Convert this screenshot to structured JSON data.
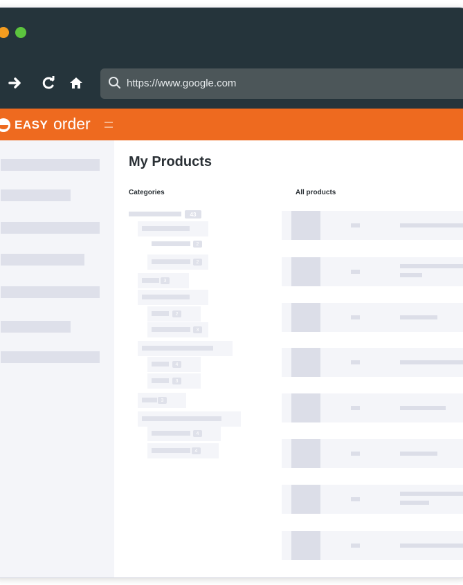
{
  "browser": {
    "url": "https://www.google.com",
    "colors": {
      "chrome": "#25343b",
      "url_bar": "#4c5659",
      "dot_orange": "#f39c1f",
      "dot_green": "#5cc43e"
    },
    "icons": [
      "forward-icon",
      "reload-icon",
      "home-icon",
      "search-icon"
    ]
  },
  "brand": {
    "part1": "EASY",
    "part2": "order",
    "color": "#ee6a1f"
  },
  "page": {
    "title": "My Products",
    "categories_label": "Categories",
    "all_products_label": "All products",
    "category_badges": [
      "43",
      "2",
      "2",
      "3",
      "2",
      "3",
      "4",
      "3",
      "3",
      "4",
      "4"
    ]
  }
}
